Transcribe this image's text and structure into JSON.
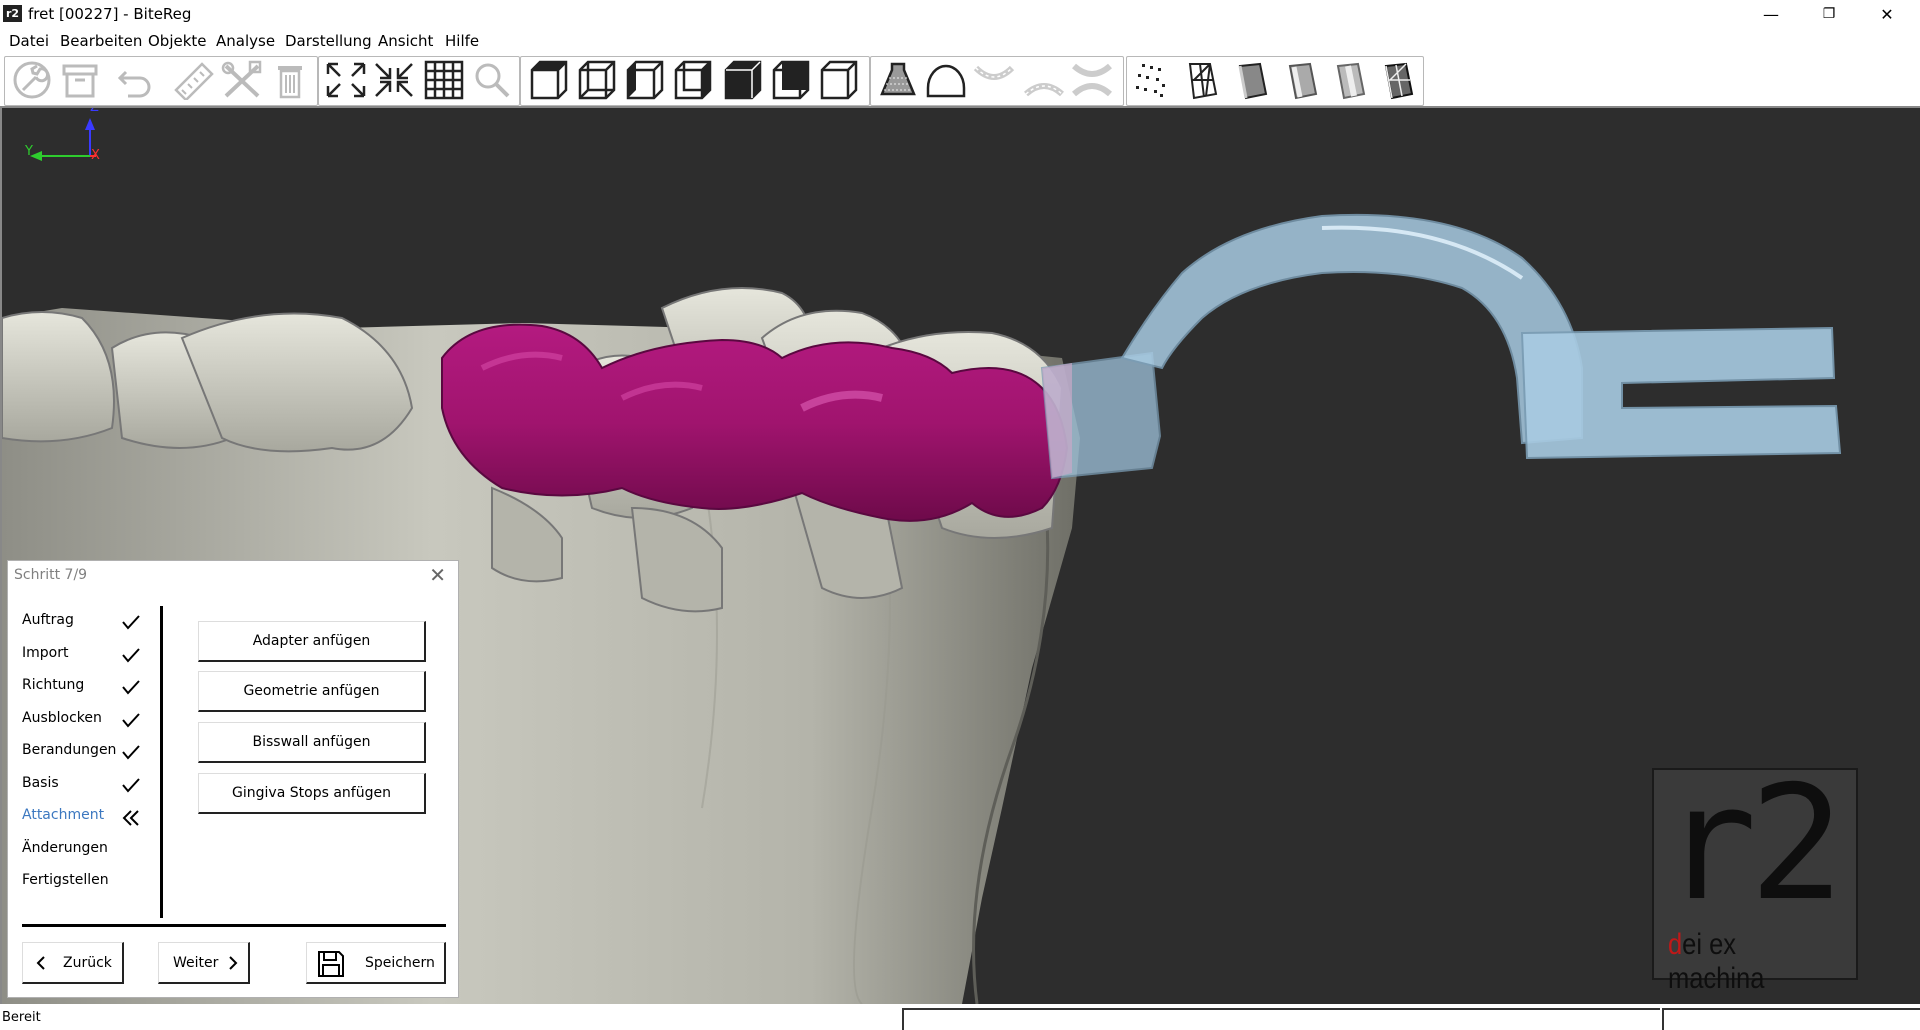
{
  "window": {
    "title": "fret [00227] - BiteReg",
    "app_icon": "r2",
    "minimize": "—",
    "restore": "❐",
    "close": "✕"
  },
  "menu": [
    "Datei",
    "Bearbeiten",
    "Objekte",
    "Analyse",
    "Darstellung",
    "Ansicht",
    "Hilfe"
  ],
  "toolbar": {
    "icons": [
      "wrench-icon",
      "archive-icon",
      "undo-icon",
      "ruler-icon",
      "tools-icon",
      "trash-icon",
      "zoom-fit-icon",
      "zoom-in-icon",
      "grid-icon",
      "magnifier-icon",
      "view-front-icon",
      "view-back-icon",
      "view-left-icon",
      "view-right-icon",
      "view-top-icon",
      "view-bottom-icon",
      "view-iso-icon",
      "shade-icon",
      "dome-icon",
      "upper-jaw-icon",
      "lower-jaw-icon",
      "both-jaws-icon",
      "points-icon",
      "mesh-icon",
      "cylinder-icon",
      "cylinder-smooth-icon",
      "cylinder-solid-icon",
      "cylinder-wire-icon"
    ]
  },
  "axes": {
    "z": "Z",
    "y": "Y",
    "x": "X"
  },
  "wizard": {
    "title": "Schritt 7/9",
    "close": "✕",
    "steps": [
      {
        "label": "Auftrag",
        "state": "done"
      },
      {
        "label": "Import",
        "state": "done"
      },
      {
        "label": "Richtung",
        "state": "done"
      },
      {
        "label": "Ausblocken",
        "state": "done"
      },
      {
        "label": "Berandungen",
        "state": "done"
      },
      {
        "label": "Basis",
        "state": "done"
      },
      {
        "label": "Attachment",
        "state": "current"
      },
      {
        "label": "Änderungen",
        "state": "pending"
      },
      {
        "label": "Fertigstellen",
        "state": "pending"
      }
    ],
    "actions": [
      "Adapter anfügen",
      "Geometrie anfügen",
      "Bisswall anfügen",
      "Gingiva Stops anfügen"
    ],
    "back_label": "Zurück",
    "next_label": "Weiter",
    "save_label": "Speichern"
  },
  "logo": {
    "main": "r2",
    "sub_first": "d",
    "sub_rest": "ei ex machina"
  },
  "status": {
    "text": "Bereit"
  },
  "colors": {
    "background": "#2d2d2d",
    "teeth": "#c9c9bd",
    "bite_wall": "#a0146e",
    "adapter": "#9fc3dc",
    "active_step": "#3c78c0"
  }
}
